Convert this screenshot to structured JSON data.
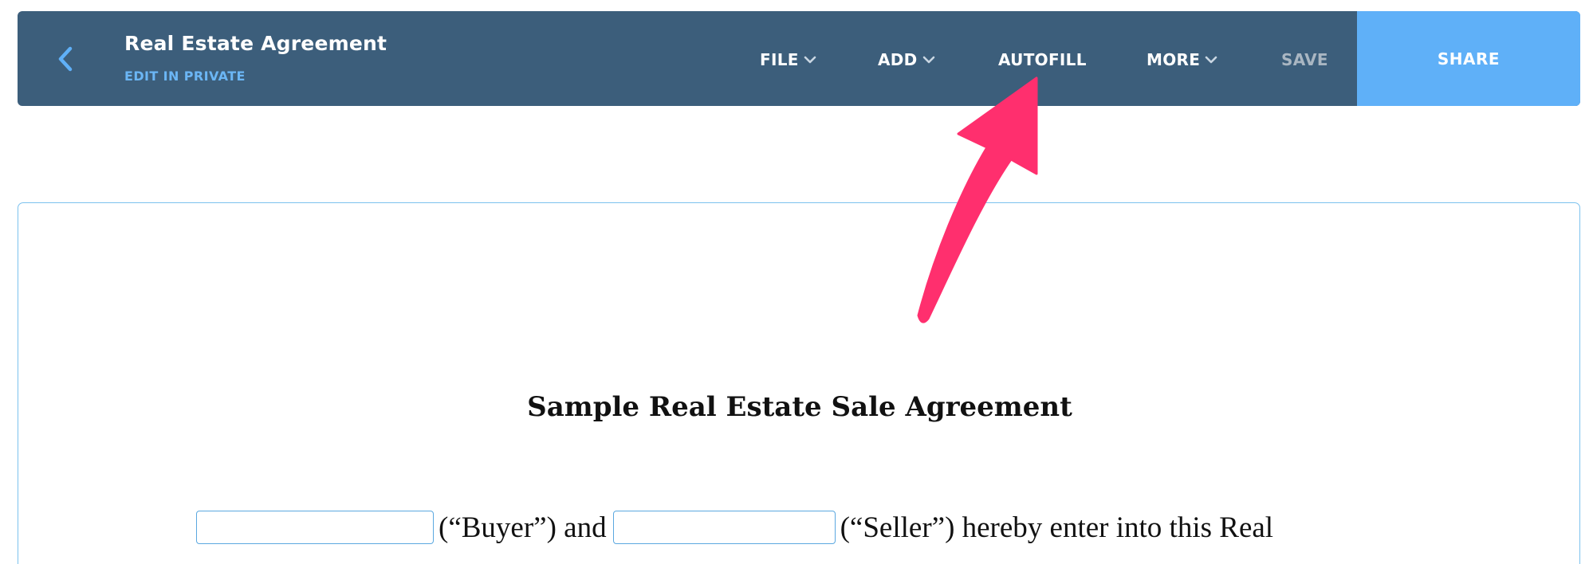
{
  "header": {
    "title": "Real Estate Agreement",
    "subtitle": "EDIT IN PRIVATE",
    "back_icon": "chevron-left-icon",
    "menu": {
      "file": "FILE",
      "add": "ADD",
      "autofill": "AUTOFILL",
      "more": "MORE",
      "save": "SAVE"
    },
    "share": "SHARE"
  },
  "document": {
    "heading": "Sample Real Estate Sale Agreement",
    "buyer_text": "(“Buyer”) and",
    "seller_text": "(“Seller”) hereby enter into this Real",
    "buyer_value": "",
    "seller_value": ""
  },
  "annotation": {
    "arrow_color": "#ff2f6e",
    "points_to": "AUTOFILL"
  },
  "colors": {
    "topbar": "#3c5e7b",
    "share": "#5fb0f8",
    "accent": "#6bb6f5"
  }
}
